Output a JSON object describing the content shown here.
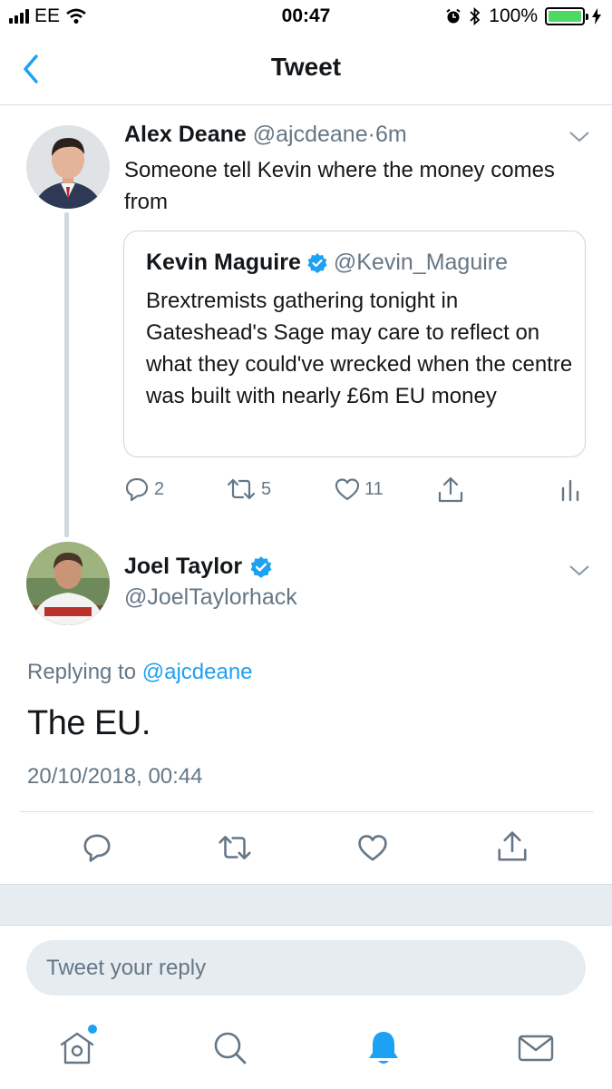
{
  "status_bar": {
    "carrier": "EE",
    "time": "00:47",
    "battery": "100%",
    "battery_level": 1.0
  },
  "nav": {
    "title": "Tweet"
  },
  "tweet1": {
    "name": "Alex Deane",
    "handle": "@ajcdeane",
    "separator": "·",
    "age": "6m",
    "text": "Someone tell Kevin where the money comes from"
  },
  "quote": {
    "name": "Kevin Maguire",
    "handle": "@Kevin_Maguire",
    "text": "Brextremists gathering tonight in Gateshead's Sage may care to reflect on what they could've wrecked when the centre was built with nearly £6m EU money"
  },
  "tweet1_actions": {
    "replies": "2",
    "retweets": "5",
    "likes": "11"
  },
  "tweet2": {
    "name": "Joel Taylor",
    "handle": "@JoelTaylorhack",
    "replying_prefix": "Replying to",
    "replying_to": "@ajcdeane",
    "text": "The EU.",
    "timestamp": "20/10/2018, 00:44"
  },
  "reply_box": {
    "placeholder": "Tweet your reply"
  },
  "icons": {
    "back": "chevron-left-icon",
    "more": "chevron-down-icon",
    "verified": "verified-badge-icon",
    "reply": "comment-icon",
    "retweet": "retweet-icon",
    "like": "heart-icon",
    "share": "share-icon",
    "analytics": "analytics-icon",
    "home": "home-icon",
    "search": "search-icon",
    "notifications": "bell-icon",
    "messages": "envelope-icon"
  },
  "colors": {
    "accent": "#1da1f2",
    "secondary_text": "#657786",
    "primary_text": "#14171a",
    "battery_green": "#4cd964"
  }
}
